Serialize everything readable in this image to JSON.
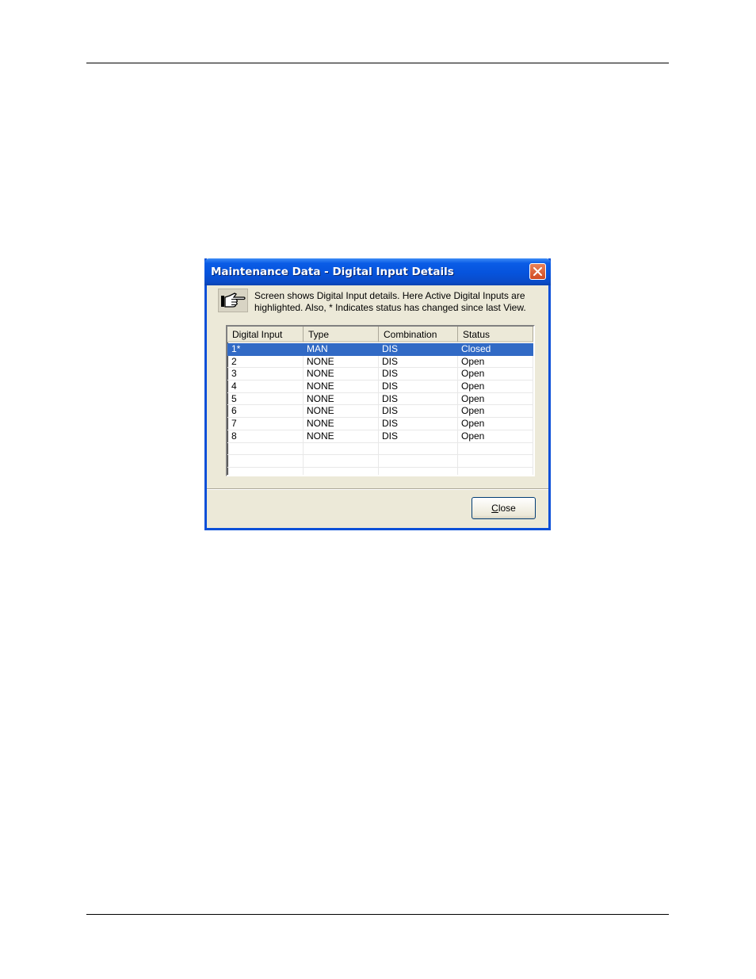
{
  "dialog": {
    "title": "Maintenance Data - Digital Input Details",
    "info_text": "Screen shows Digital Input details. Here Active Digital Inputs are highlighted.  Also,  * Indicates status has changed since last View.",
    "close_button_label": "Close",
    "icons": {
      "info": "pointing-hand-icon",
      "close": "close-icon"
    },
    "colors": {
      "titlebar": "#0653dc",
      "selection": "#316ac5",
      "dialog_bg": "#ece9d8",
      "close_x": "#d14b22"
    }
  },
  "table": {
    "columns": [
      "Digital Input",
      "Type",
      "Combination",
      "Status"
    ],
    "rows": [
      [
        "1*",
        "MAN",
        "DIS",
        "Closed"
      ],
      [
        "2",
        "NONE",
        "DIS",
        "Open"
      ],
      [
        "3",
        "NONE",
        "DIS",
        "Open"
      ],
      [
        "4",
        "NONE",
        "DIS",
        "Open"
      ],
      [
        "5",
        "NONE",
        "DIS",
        "Open"
      ],
      [
        "6",
        "NONE",
        "DIS",
        "Open"
      ],
      [
        "7",
        "NONE",
        "DIS",
        "Open"
      ],
      [
        "8",
        "NONE",
        "DIS",
        "Open"
      ]
    ],
    "selected_row": 0,
    "empty_rows": 3
  }
}
